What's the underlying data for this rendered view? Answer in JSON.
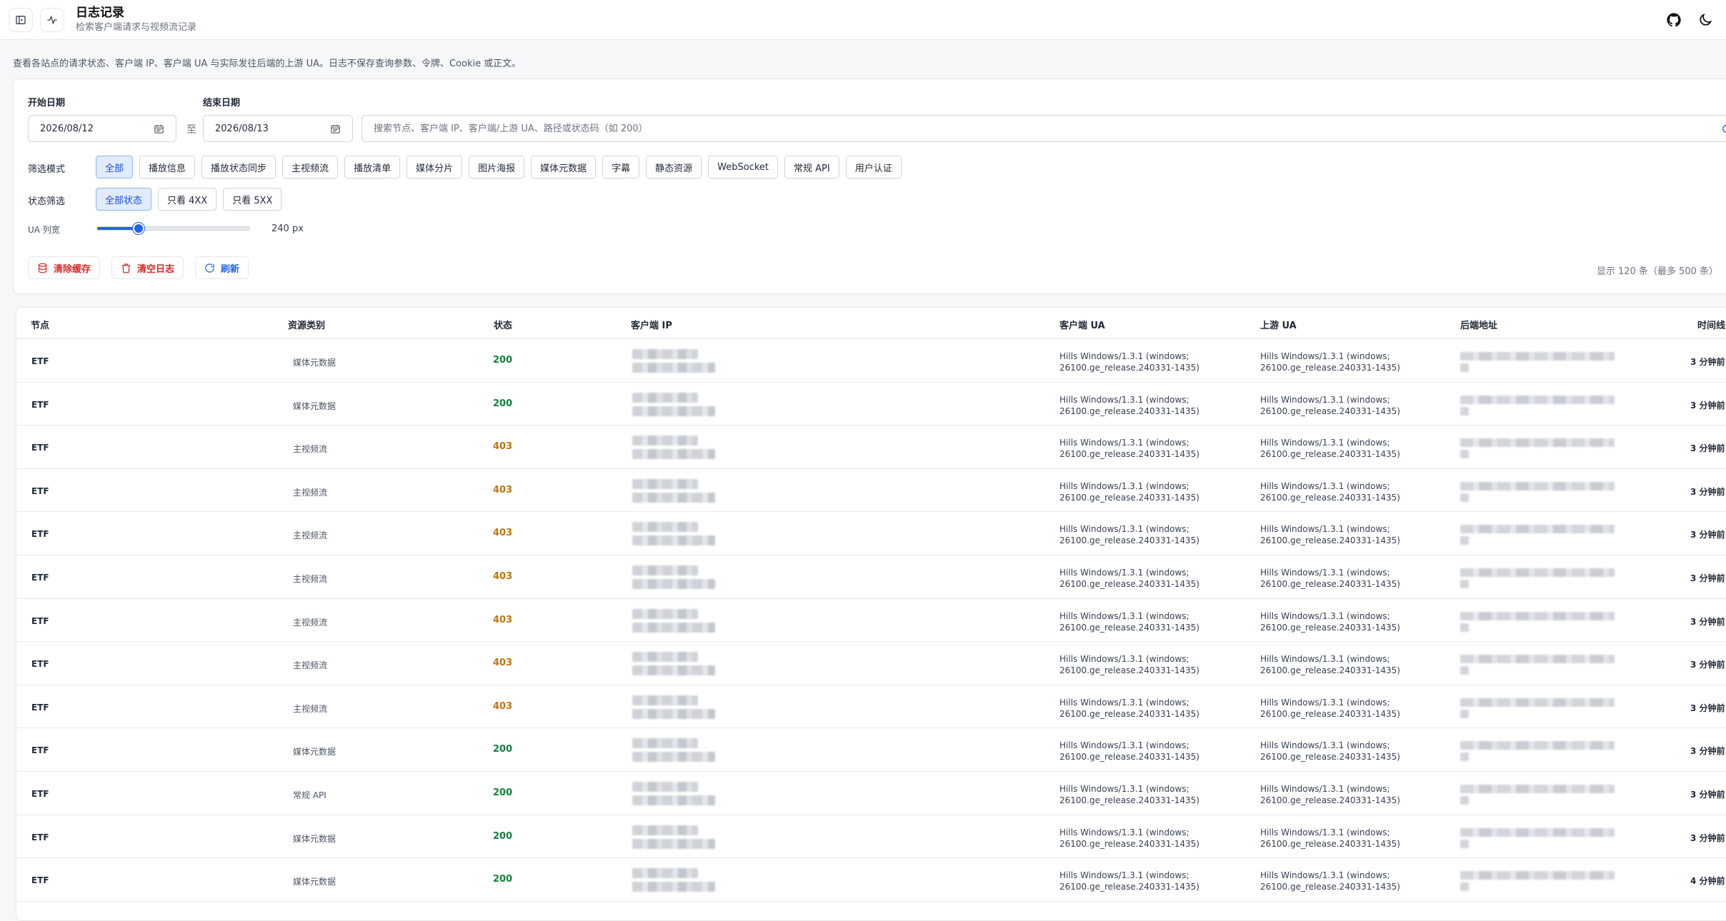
{
  "header": {
    "title": "日志记录",
    "subtitle": "检索客户端请求与视频流记录"
  },
  "description": "查看各站点的请求状态、客户端 IP、客户端 UA 与实际发往后端的上游 UA。日志不保存查询参数、令牌、Cookie 或正文。",
  "filters": {
    "start_label": "开始日期",
    "start_value": "2026/08/12",
    "to_label": "至",
    "end_label": "结束日期",
    "end_value": "2026/08/13",
    "search_placeholder": "搜索节点、客户端 IP、客户端/上游 UA、路径或状态码（如 200）",
    "mode_label": "筛选模式",
    "modes": [
      "全部",
      "播放信息",
      "播放状态同步",
      "主视频流",
      "播放清单",
      "媒体分片",
      "图片海报",
      "媒体元数据",
      "字幕",
      "静态资源",
      "WebSocket",
      "常规 API",
      "用户认证"
    ],
    "status_label": "状态筛选",
    "statuses": [
      "全部状态",
      "只看 4XX",
      "只看 5XX"
    ],
    "ua_width_label": "UA 列宽",
    "ua_width_value": "240 px",
    "ua_width_fraction": 0.27
  },
  "actions": {
    "clear_cache": "清除缓存",
    "clear_logs": "清空日志",
    "refresh": "刷新",
    "count": "显示 120 条（最多 500 条）"
  },
  "table": {
    "columns": [
      "节点",
      "资源类别",
      "状态",
      "客户端 IP",
      "客户端 UA",
      "上游 UA",
      "后端地址",
      "时间线"
    ],
    "ua_line1": "Hills Windows/1.3.1 (windows;",
    "ua_line2": "26100.ge_release.240331-1435)",
    "rows": [
      {
        "node": "ETF",
        "type": "媒体元数据",
        "status": "200",
        "time": "3 分钟前"
      },
      {
        "node": "ETF",
        "type": "媒体元数据",
        "status": "200",
        "time": "3 分钟前"
      },
      {
        "node": "ETF",
        "type": "主视频流",
        "status": "403",
        "time": "3 分钟前"
      },
      {
        "node": "ETF",
        "type": "主视频流",
        "status": "403",
        "time": "3 分钟前"
      },
      {
        "node": "ETF",
        "type": "主视频流",
        "status": "403",
        "time": "3 分钟前"
      },
      {
        "node": "ETF",
        "type": "主视频流",
        "status": "403",
        "time": "3 分钟前"
      },
      {
        "node": "ETF",
        "type": "主视频流",
        "status": "403",
        "time": "3 分钟前"
      },
      {
        "node": "ETF",
        "type": "主视频流",
        "status": "403",
        "time": "3 分钟前"
      },
      {
        "node": "ETF",
        "type": "主视频流",
        "status": "403",
        "time": "3 分钟前"
      },
      {
        "node": "ETF",
        "type": "媒体元数据",
        "status": "200",
        "time": "3 分钟前"
      },
      {
        "node": "ETF",
        "type": "常规 API",
        "status": "200",
        "time": "3 分钟前"
      },
      {
        "node": "ETF",
        "type": "媒体元数据",
        "status": "200",
        "time": "3 分钟前"
      },
      {
        "node": "ETF",
        "type": "媒体元数据",
        "status": "200",
        "time": "4 分钟前"
      }
    ]
  },
  "colors": {
    "accent": "#2563eb",
    "success": "#15803d",
    "warning": "#c2740d",
    "danger": "#dc2626"
  },
  "icons": [
    "sidebar-toggle-icon",
    "activity-icon",
    "github-icon",
    "moon-icon",
    "calendar-icon",
    "search-icon",
    "database-icon",
    "trash-icon",
    "refresh-icon"
  ]
}
